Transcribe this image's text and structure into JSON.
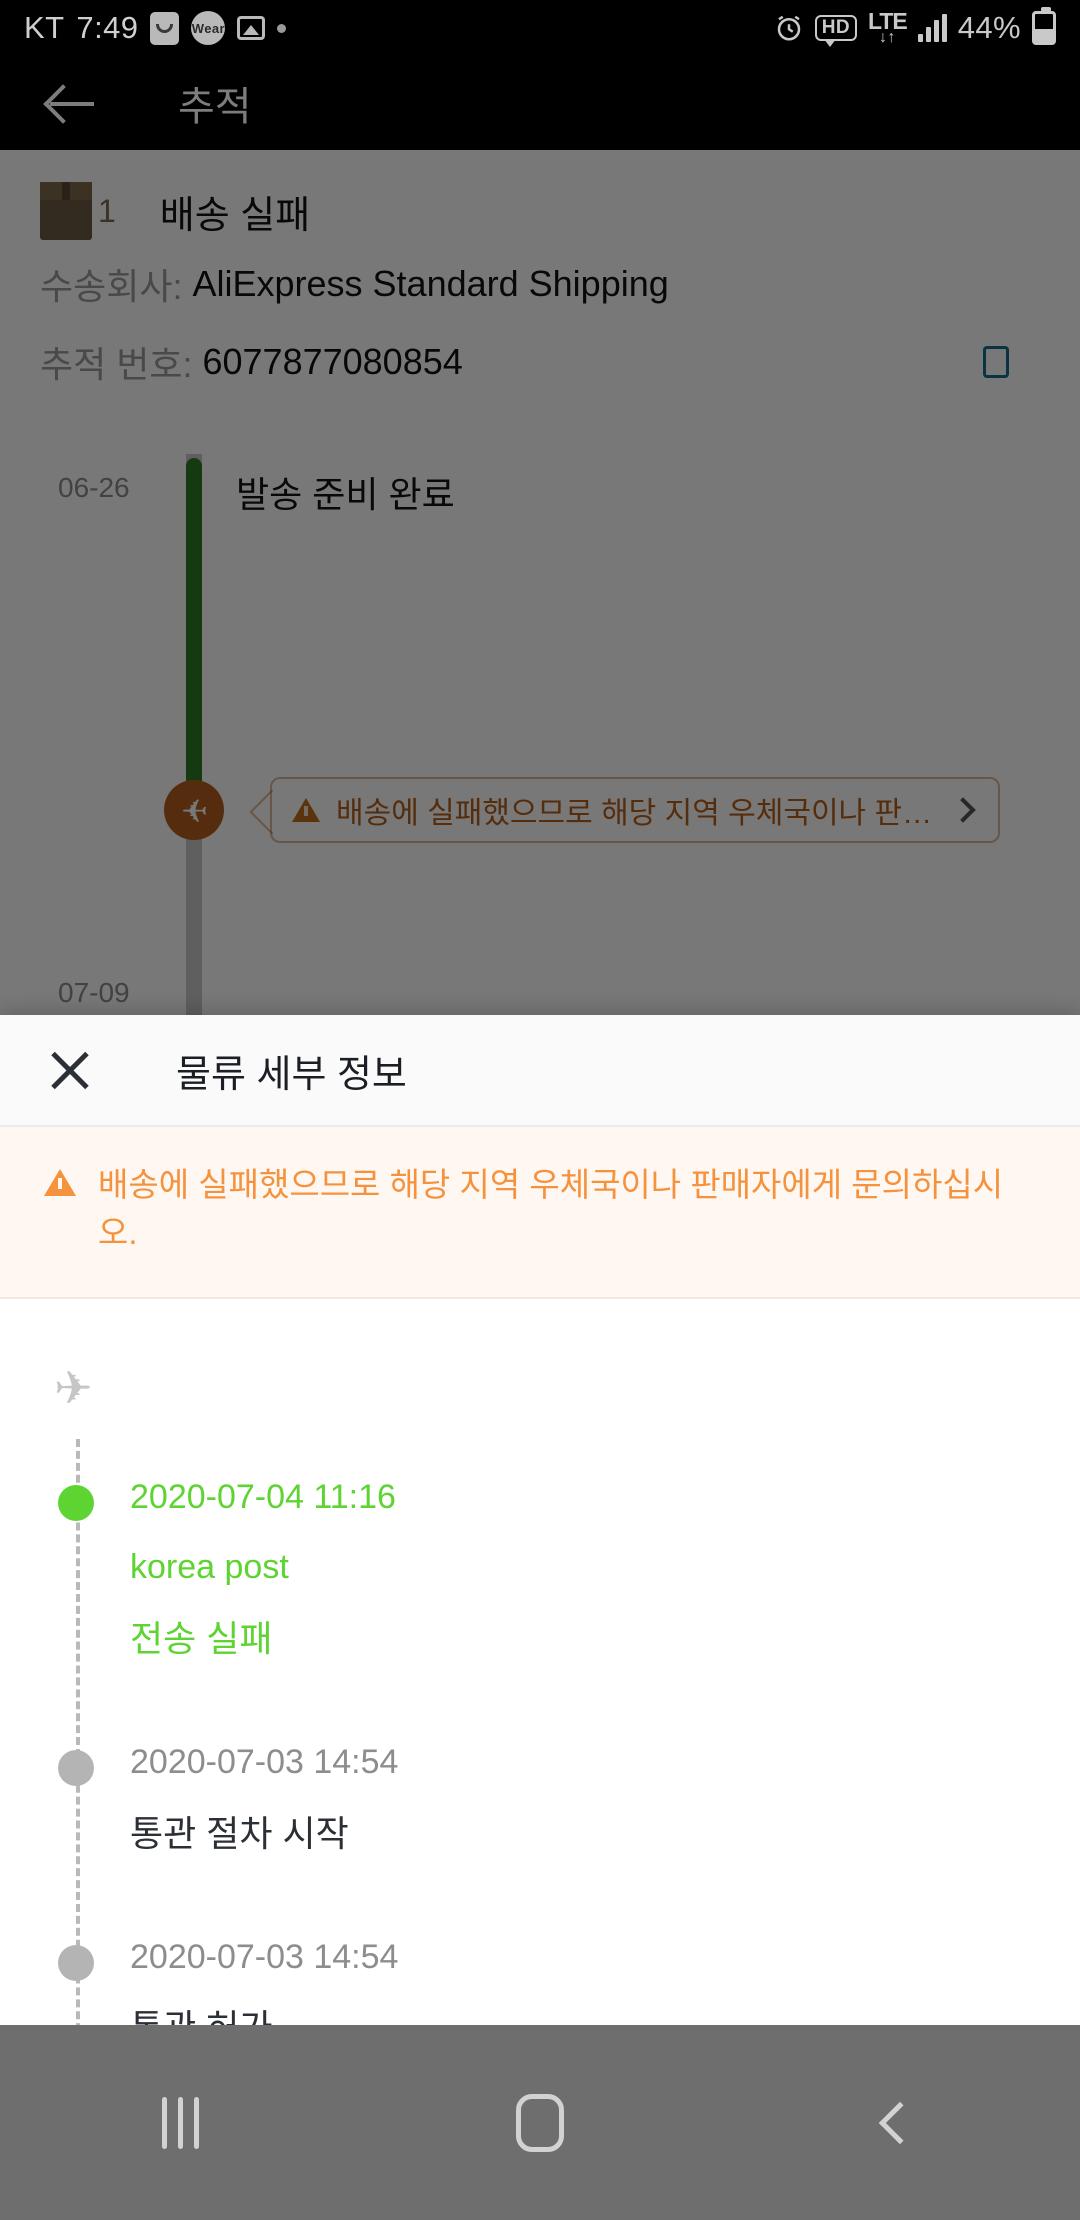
{
  "status_bar": {
    "carrier": "KT",
    "time": "7:49",
    "battery_percent": "44%",
    "network": "LTE",
    "network_plus": "+",
    "hd_label": "HD",
    "icons": [
      "alarm-icon",
      "hd-call-icon",
      "lte-plus-icon",
      "signal-bars-icon",
      "battery-icon"
    ],
    "notification_icons": [
      "app-badge-icon",
      "wear-icon",
      "gallery-icon",
      "dot-icon"
    ],
    "wear_label": "Wear"
  },
  "app_bar": {
    "back_label": "back-arrow",
    "title": "추적"
  },
  "package": {
    "count": "1",
    "status": "배송 실패",
    "carrier_key": "수송회사:",
    "carrier_value": "AliExpress Standard Shipping",
    "tracking_key": "추적 번호:",
    "tracking_value": "6077877080854",
    "copy_icon": "copy-icon"
  },
  "background_timeline": {
    "entries": [
      {
        "date": "06-26",
        "label": "발송 준비 완료"
      },
      {
        "date": "07-09",
        "label": ""
      }
    ],
    "warning_chip": {
      "text": "배송에 실패했으므로 해당 지역 우체국이나 판매...",
      "icon": "warning-triangle-icon",
      "chevron": "chevron-right-icon"
    },
    "marker_icon": "plane-marker-icon"
  },
  "sheet": {
    "close_icon": "close-icon",
    "title": "물류 세부 정보",
    "warning": {
      "icon": "warning-triangle-icon",
      "text": "배송에 실패했으므로 해당 지역 우체국이나 판매자에게 문의하십시오."
    },
    "plane_icon": "plane-icon",
    "events": [
      {
        "timestamp": "2020-07-04 11:16",
        "carrier": "korea post",
        "description": "전송 실패",
        "active": true
      },
      {
        "timestamp": "2020-07-03 14:54",
        "carrier": "",
        "description": "통관 절차 시작",
        "active": false
      },
      {
        "timestamp": "2020-07-03 14:54",
        "carrier": "",
        "description": "통관 허가",
        "active": false
      }
    ]
  },
  "nav_bar": {
    "recents_label": "recents",
    "home_label": "home",
    "back_label": "back"
  },
  "colors": {
    "accent_green": "#5ed432",
    "warning_orange": "#f5923e",
    "marker_orange": "#b4601f",
    "rail_green": "#2d7a22",
    "copy_teal": "#17708a"
  }
}
